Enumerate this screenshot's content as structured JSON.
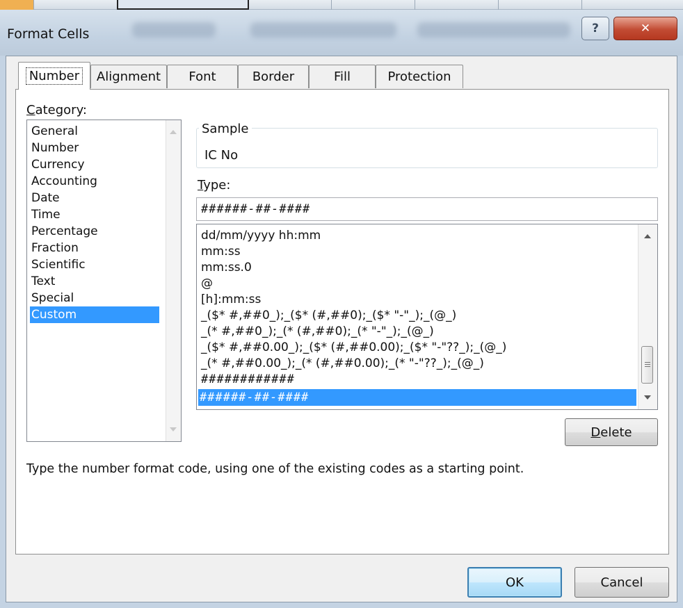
{
  "window": {
    "title": "Format Cells",
    "help_glyph": "?",
    "close_glyph": "✕"
  },
  "tabs": [
    {
      "label": "Number",
      "active": true
    },
    {
      "label": "Alignment",
      "active": false
    },
    {
      "label": "Font",
      "active": false
    },
    {
      "label": "Border",
      "active": false
    },
    {
      "label": "Fill",
      "active": false
    },
    {
      "label": "Protection",
      "active": false
    }
  ],
  "category": {
    "label_hotkey": "C",
    "label_rest": "ategory:",
    "items": [
      "General",
      "Number",
      "Currency",
      "Accounting",
      "Date",
      "Time",
      "Percentage",
      "Fraction",
      "Scientific",
      "Text",
      "Special",
      "Custom"
    ],
    "selected": "Custom"
  },
  "sample": {
    "label": "Sample",
    "value": "IC No"
  },
  "type_field": {
    "label_hotkey": "T",
    "label_rest": "ype:",
    "value": "######-##-####",
    "items": [
      "dd/mm/yyyy hh:mm",
      "mm:ss",
      "mm:ss.0",
      "@",
      "[h]:mm:ss",
      "_($* #,##0_);_($* (#,##0);_($* \"-\"_);_(@_)",
      "_(* #,##0_);_(* (#,##0);_(* \"-\"_);_(@_)",
      "_($* #,##0.00_);_($* (#,##0.00);_($* \"-\"??_);_(@_)",
      "_(* #,##0.00_);_(* (#,##0.00);_(* \"-\"??_);_(@_)",
      "############",
      "######-##-####"
    ],
    "selected": "######-##-####"
  },
  "buttons": {
    "delete_hotkey": "D",
    "delete_rest": "elete",
    "ok": "OK",
    "cancel": "Cancel"
  },
  "hint": "Type the number format code, using one of the existing codes as a starting point.",
  "colors": {
    "selection": "#3399ff",
    "close_button": "#c24c34",
    "title_bar": "#c9d6e4"
  }
}
